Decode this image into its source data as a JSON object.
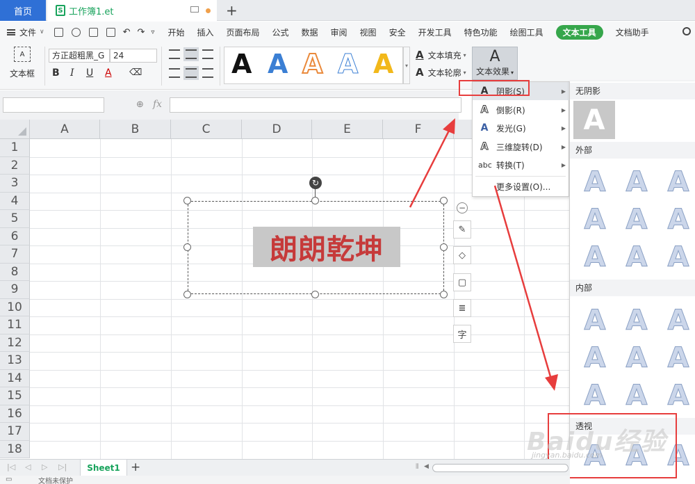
{
  "tabs": {
    "home": "首页",
    "document": "工作簿1.et",
    "doc_icon": "S"
  },
  "menu": {
    "file": "文件",
    "items": [
      "开始",
      "插入",
      "页面布局",
      "公式",
      "数据",
      "审阅",
      "视图",
      "安全",
      "开发工具",
      "特色功能",
      "绘图工具",
      "文本工具",
      "文档助手"
    ],
    "active": "文本工具"
  },
  "ribbon": {
    "textbox": "文本框",
    "textbox_icon": "A",
    "font": "方正超粗黑_G",
    "size": "24",
    "bold": "B",
    "italic": "I",
    "underline": "U",
    "fontcolor": "A",
    "gallery": [
      {
        "glyph": "A",
        "color": "#111111"
      },
      {
        "glyph": "A",
        "color": "#3b7fd4"
      },
      {
        "glyph": "A",
        "color": "#ea8a3c"
      },
      {
        "glyph": "A",
        "color": "#ffffff"
      },
      {
        "glyph": "A",
        "color": "#f2b81a"
      }
    ],
    "text_fill": "文本填充",
    "text_outline": "文本轮廓",
    "text_effect": "文本效果",
    "tool_glyph": "A"
  },
  "formula": {
    "fx": "fx"
  },
  "sheet": {
    "columns": [
      "A",
      "B",
      "C",
      "D",
      "E",
      "F"
    ],
    "rows": [
      "1",
      "2",
      "3",
      "4",
      "5",
      "6",
      "7",
      "8",
      "9",
      "10",
      "11",
      "12",
      "13",
      "14",
      "15",
      "16",
      "17",
      "18"
    ],
    "wordart": "朗朗乾坤"
  },
  "side_toolbar": {
    "minus": "−",
    "char": "字"
  },
  "effect_menu": {
    "items": [
      {
        "icon": "A",
        "label": "阴影(S)",
        "submenu": true
      },
      {
        "icon": "A",
        "label": "倒影(R)",
        "submenu": true
      },
      {
        "icon": "A",
        "label": "发光(G)",
        "submenu": true
      },
      {
        "icon": "A",
        "label": "三维旋转(D)",
        "submenu": true
      },
      {
        "icon": "abc",
        "label": "转换(T)",
        "submenu": true
      },
      {
        "icon": "",
        "label": "更多设置(O)...",
        "submenu": false
      }
    ]
  },
  "shadow_panel": {
    "none": "无阴影",
    "outer": "外部",
    "inner": "内部",
    "perspective": "透视",
    "glyph": "A"
  },
  "sheets": {
    "active": "Sheet1"
  },
  "status": {
    "text": "文档未保护"
  },
  "watermark": {
    "text": "Baidu经验",
    "url": "jingyan.baidu.com"
  }
}
